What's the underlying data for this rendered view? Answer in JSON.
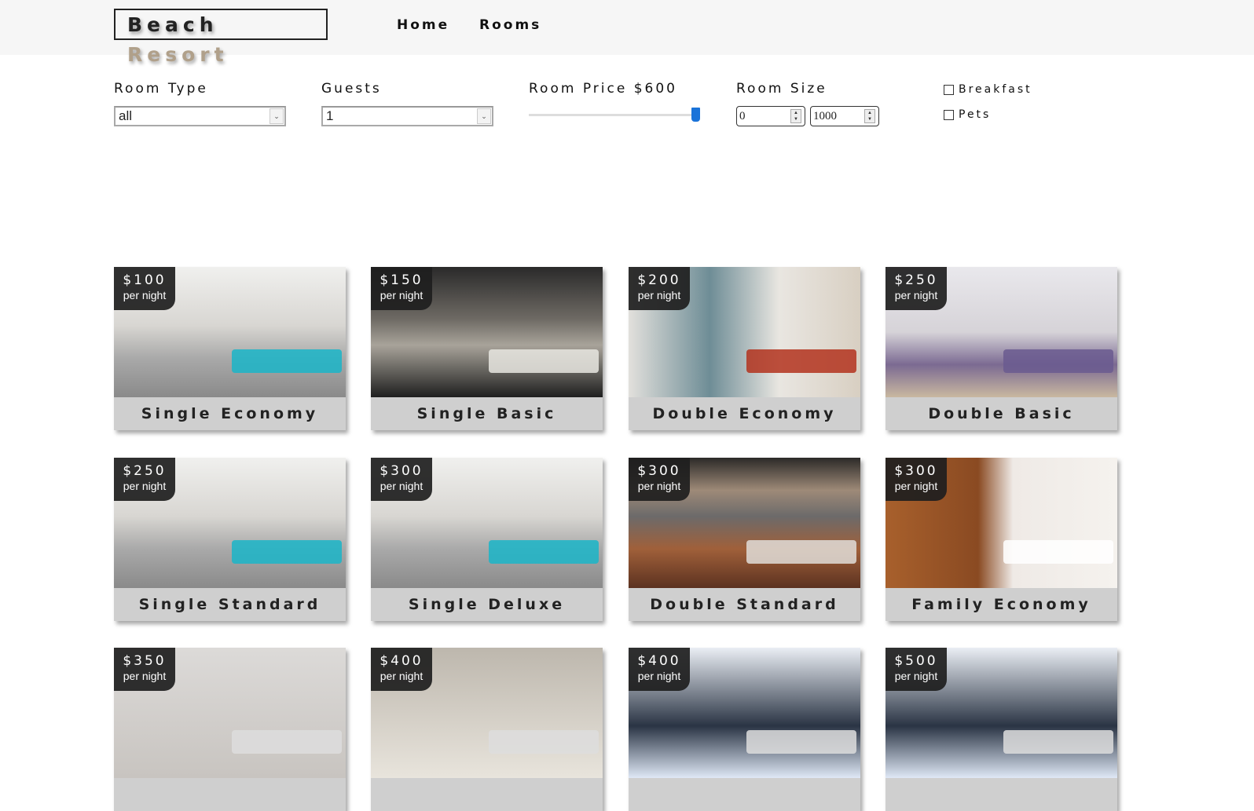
{
  "nav": {
    "logo_first": "Beach",
    "logo_second": "Resort",
    "links": [
      "Home",
      "Rooms"
    ]
  },
  "filters": {
    "room_type": {
      "label": "Room Type",
      "value": "all"
    },
    "guests": {
      "label": "Guests",
      "value": "1"
    },
    "price": {
      "label": "Room Price $600",
      "value": 600,
      "max": 600
    },
    "size": {
      "label": "Room Size",
      "min": "0",
      "max": "1000"
    },
    "breakfast": {
      "label": "Breakfast",
      "checked": false
    },
    "pets": {
      "label": "Pets",
      "checked": false
    }
  },
  "per_night": "per night",
  "rooms": [
    {
      "price": "$100",
      "name": "Single Economy",
      "bg": "linear-gradient(180deg,#f0f0ee 0%,#d8d6d2 45%,#a9a9a9 70%,#8a8a8a 100%)",
      "accent": "#1ab5c8"
    },
    {
      "price": "$150",
      "name": "Single Basic",
      "bg": "linear-gradient(180deg,#2a2a2a 0%,#6e6a64 40%,#a8a39a 60%,#1f1f1f 100%)",
      "accent": "#e8e6e0"
    },
    {
      "price": "$200",
      "name": "Double Economy",
      "bg": "linear-gradient(90deg,#e2e0dc 0%,#6e8d96 35%,#e9e6e1 65%,#d8cfc2 100%)",
      "accent": "#b3321d"
    },
    {
      "price": "$250",
      "name": "Double Basic",
      "bg": "linear-gradient(180deg,#e9e8ec 0%,#d6d3d8 50%,#7b6a92 75%,#c9b8a0 100%)",
      "accent": "#6a5a8f"
    },
    {
      "price": "$250",
      "name": "Single Standard",
      "bg": "linear-gradient(180deg,#f0f0ee 0%,#d8d6d2 45%,#a9a9a9 70%,#8a8a8a 100%)",
      "accent": "#1ab5c8"
    },
    {
      "price": "$300",
      "name": "Single Deluxe",
      "bg": "linear-gradient(180deg,#f0f0ee 0%,#d8d6d2 45%,#a9a9a9 70%,#8a8a8a 100%)",
      "accent": "#1ab5c8"
    },
    {
      "price": "$300",
      "name": "Double Standard",
      "bg": "linear-gradient(180deg,#2c2a28 0%,#9e8a78 25%,#6c6a6a 45%,#a0603a 70%,#5c3220 100%)",
      "accent": "#e0ddd8"
    },
    {
      "price": "$300",
      "name": "Family Economy",
      "bg": "linear-gradient(90deg,#a8602c 0%,#8a4a22 40%,#efeae6 55%,#f5f2ee 100%)",
      "accent": "#ffffff"
    },
    {
      "price": "$350",
      "name": "",
      "bg": "linear-gradient(180deg,#dcdad8,#c8c4c0)",
      "accent": "#ddd"
    },
    {
      "price": "$400",
      "name": "",
      "bg": "linear-gradient(180deg,#bdb7ad,#e8e4dc)",
      "accent": "#ddd"
    },
    {
      "price": "$400",
      "name": "",
      "bg": "linear-gradient(180deg,#eaeef4,#2a3444 60%,#dfe8f6)",
      "accent": "#ddd"
    },
    {
      "price": "$500",
      "name": "",
      "bg": "linear-gradient(180deg,#eaeef4,#2a3444 60%,#dfe8f6)",
      "accent": "#ddd"
    }
  ]
}
